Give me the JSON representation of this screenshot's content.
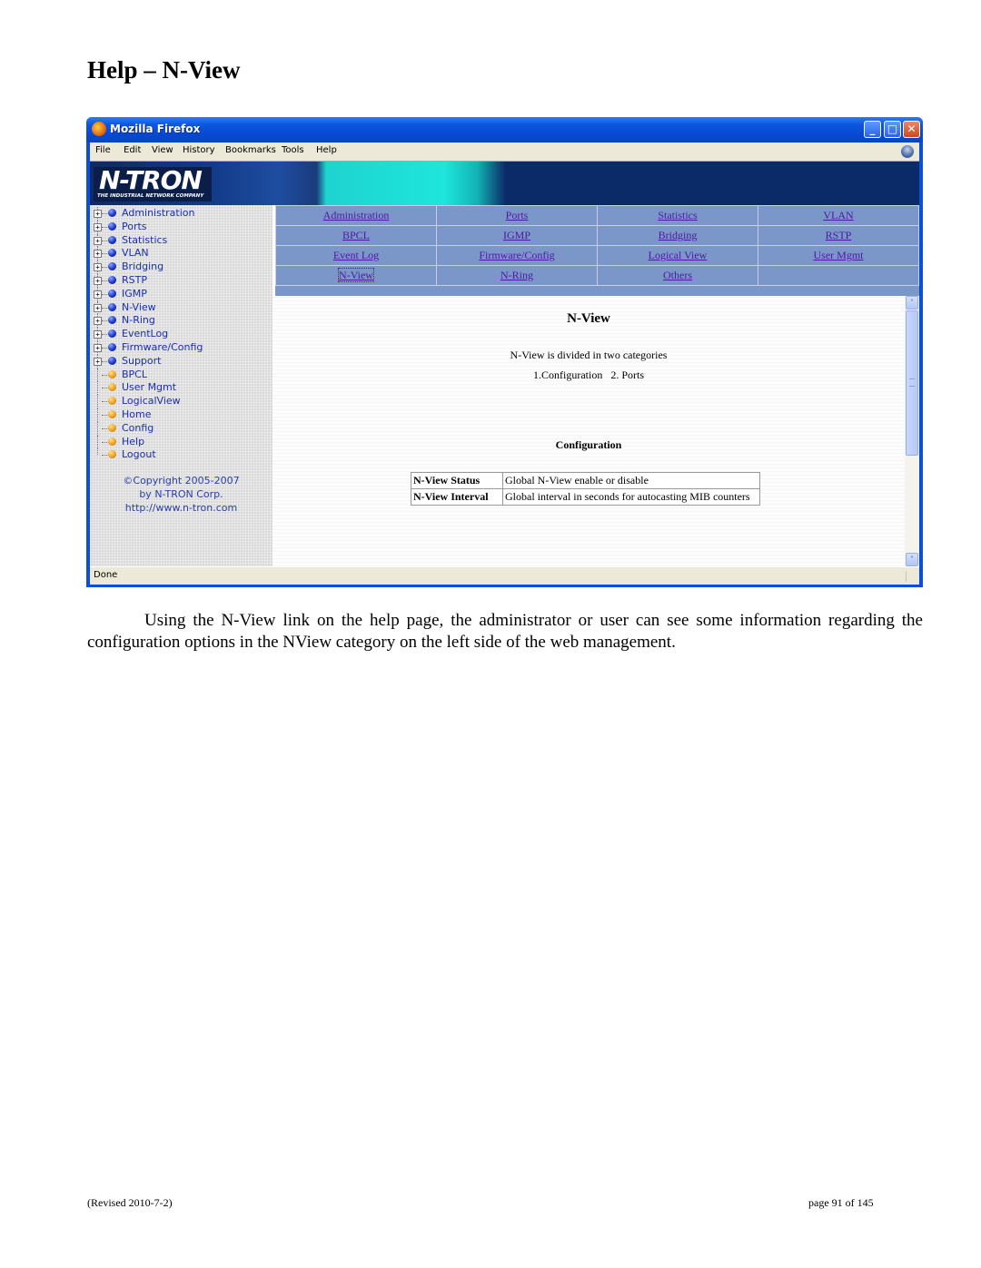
{
  "document": {
    "title": "Help – N-View",
    "paragraph": "Using the N-View link on the help page, the administrator or user can see some information regarding the configuration options in the NView category on the left side of the web management.",
    "footer_left": "(Revised 2010-7-2)",
    "footer_right": "page 91 of 145"
  },
  "browser": {
    "window_title": "Mozilla Firefox",
    "window_buttons": {
      "minimize": "_",
      "maximize": "□",
      "close": "✕"
    },
    "menu": [
      "File",
      "Edit",
      "View",
      "History",
      "Bookmarks",
      "Tools",
      "Help"
    ],
    "status": "Done"
  },
  "banner": {
    "logo_text": "N-TRON",
    "logo_subtext": "THE INDUSTRIAL NETWORK COMPANY"
  },
  "sidebar": {
    "items": [
      {
        "label": "Administration",
        "expandable": true,
        "bullet": "blue"
      },
      {
        "label": "Ports",
        "expandable": true,
        "bullet": "blue"
      },
      {
        "label": "Statistics",
        "expandable": true,
        "bullet": "blue"
      },
      {
        "label": "VLAN",
        "expandable": true,
        "bullet": "blue"
      },
      {
        "label": "Bridging",
        "expandable": true,
        "bullet": "blue"
      },
      {
        "label": "RSTP",
        "expandable": true,
        "bullet": "blue"
      },
      {
        "label": "IGMP",
        "expandable": true,
        "bullet": "blue"
      },
      {
        "label": "N-View",
        "expandable": true,
        "bullet": "blue"
      },
      {
        "label": "N-Ring",
        "expandable": true,
        "bullet": "blue"
      },
      {
        "label": "EventLog",
        "expandable": true,
        "bullet": "blue"
      },
      {
        "label": "Firmware/Config",
        "expandable": true,
        "bullet": "blue"
      },
      {
        "label": "Support",
        "expandable": true,
        "bullet": "blue"
      },
      {
        "label": "BPCL",
        "expandable": false,
        "bullet": "orange"
      },
      {
        "label": "User Mgmt",
        "expandable": false,
        "bullet": "orange"
      },
      {
        "label": "LogicalView",
        "expandable": false,
        "bullet": "orange"
      },
      {
        "label": "Home",
        "expandable": false,
        "bullet": "orange"
      },
      {
        "label": "Config",
        "expandable": false,
        "bullet": "orange"
      },
      {
        "label": "Help",
        "expandable": false,
        "bullet": "orange"
      },
      {
        "label": "Logout",
        "expandable": false,
        "bullet": "orange"
      }
    ],
    "copyright": [
      "©Copyright 2005-2007",
      "by N-TRON Corp.",
      "http://www.n-tron.com"
    ]
  },
  "help_nav": {
    "rows": [
      [
        "Administration",
        "Ports",
        "Statistics",
        "VLAN"
      ],
      [
        "BPCL",
        "IGMP",
        "Bridging",
        "RSTP"
      ],
      [
        "Event Log",
        "Firmware/Config",
        "Logical View",
        "User Mgmt"
      ],
      [
        "N-View",
        "N-Ring",
        "Others",
        ""
      ]
    ],
    "active": "N-View"
  },
  "help": {
    "title": "N-View",
    "intro": "N-View is divided in two categories",
    "categories": "1.Configuration   2. Ports",
    "section": "Configuration",
    "table": [
      {
        "key": "N-View Status",
        "value": "Global N-View enable or disable"
      },
      {
        "key": "N-View Interval",
        "value": "Global interval in seconds for autocasting MIB counters"
      }
    ]
  },
  "scrollbar": {
    "up": "˄",
    "down": "˅"
  }
}
